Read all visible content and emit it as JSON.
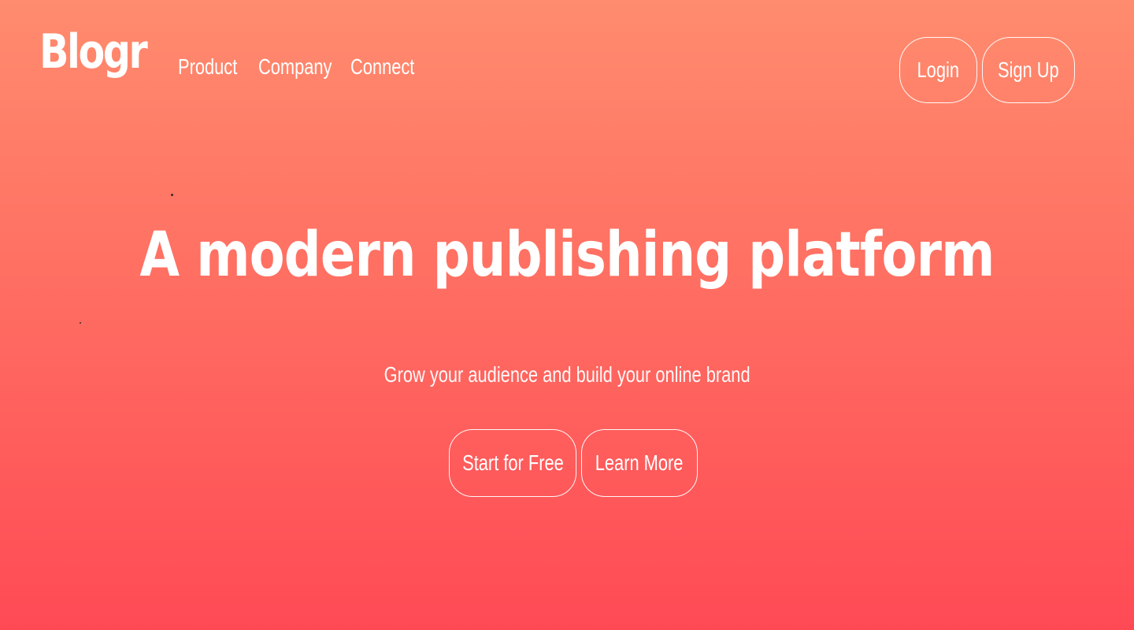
{
  "brand": {
    "name": "Blogr"
  },
  "nav": {
    "items": [
      {
        "label": "Product"
      },
      {
        "label": "Company"
      },
      {
        "label": "Connect"
      }
    ]
  },
  "auth": {
    "login_label": "Login",
    "signup_label": "Sign Up"
  },
  "hero": {
    "title": "A modern publishing platform",
    "subtitle": "Grow your audience and build your online brand",
    "primary_cta": "Start for Free",
    "secondary_cta": "Learn More"
  },
  "colors": {
    "gradient_top": "#ff8c6e",
    "gradient_bottom": "#ff4a55",
    "text": "#ffffff"
  }
}
